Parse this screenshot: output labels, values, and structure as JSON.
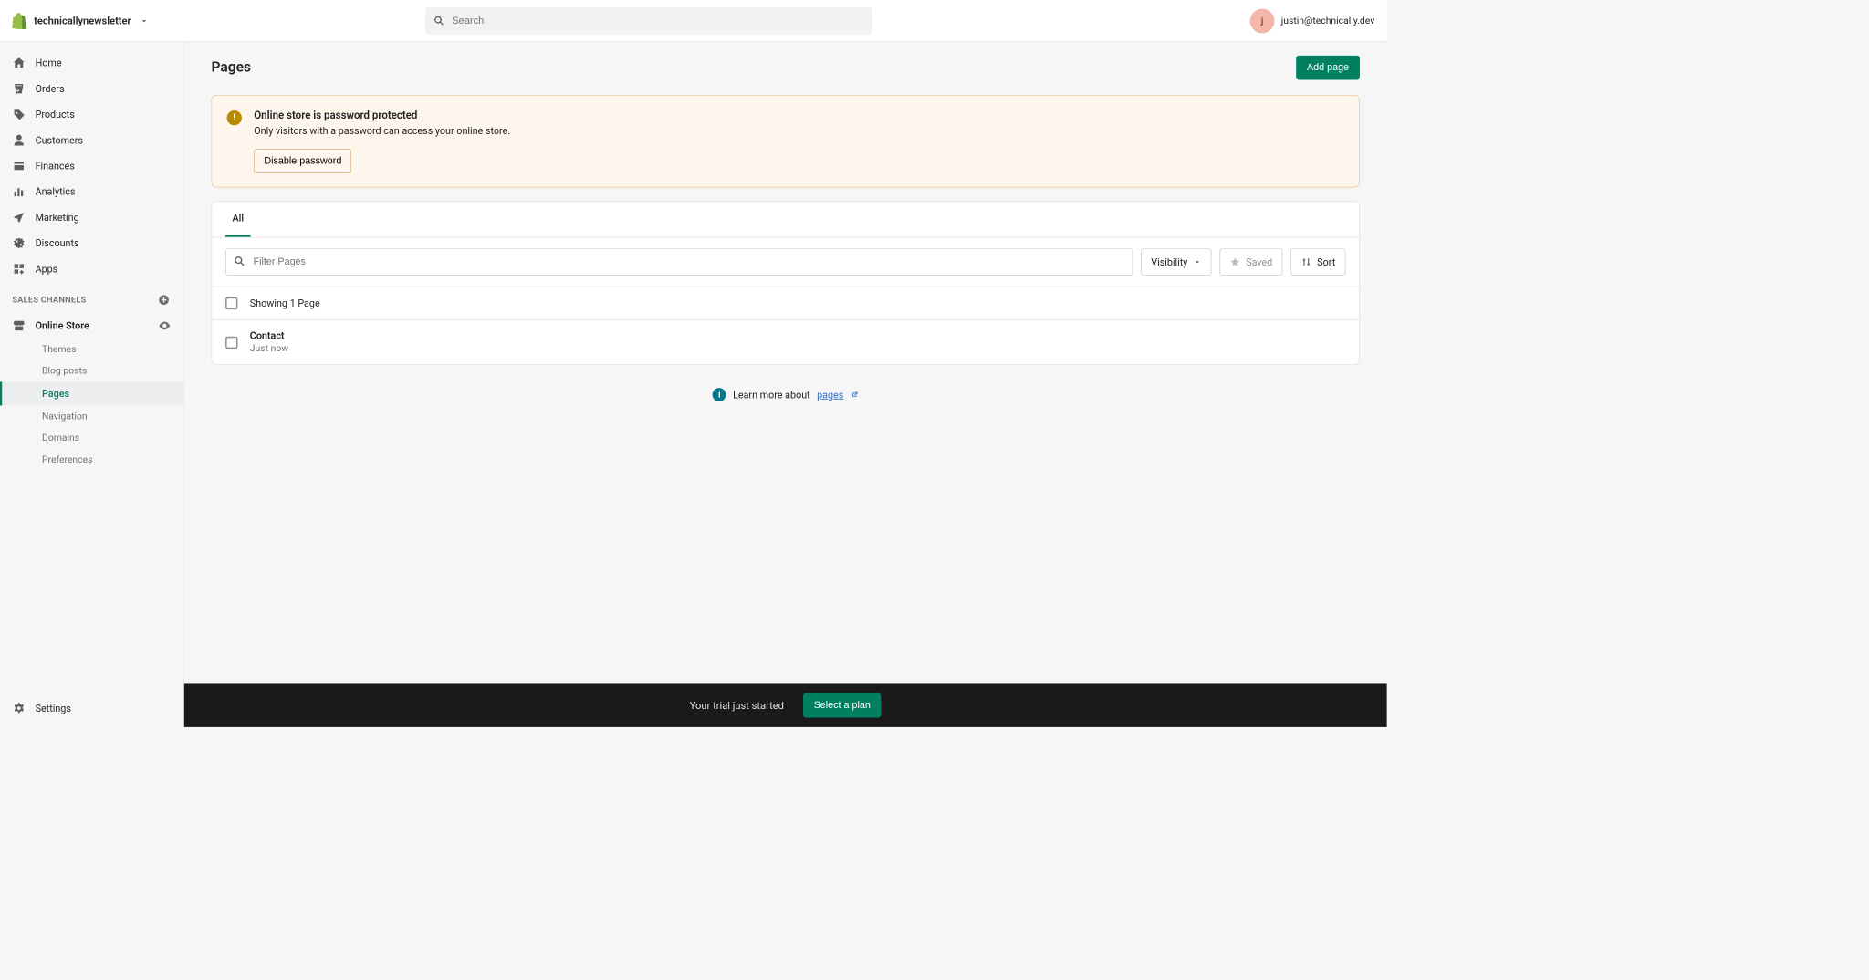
{
  "topbar": {
    "store_name": "technicallynewsletter",
    "search_placeholder": "Search",
    "avatar_initial": "j",
    "user_email": "justin@technically.dev"
  },
  "sidebar": {
    "items": [
      {
        "label": "Home",
        "icon": "home"
      },
      {
        "label": "Orders",
        "icon": "orders"
      },
      {
        "label": "Products",
        "icon": "products"
      },
      {
        "label": "Customers",
        "icon": "customers"
      },
      {
        "label": "Finances",
        "icon": "finances"
      },
      {
        "label": "Analytics",
        "icon": "analytics"
      },
      {
        "label": "Marketing",
        "icon": "marketing"
      },
      {
        "label": "Discounts",
        "icon": "discounts"
      },
      {
        "label": "Apps",
        "icon": "apps"
      }
    ],
    "section_header": "SALES CHANNELS",
    "online_store_label": "Online Store",
    "sub_items": [
      {
        "label": "Themes"
      },
      {
        "label": "Blog posts"
      },
      {
        "label": "Pages",
        "active": true
      },
      {
        "label": "Navigation"
      },
      {
        "label": "Domains"
      },
      {
        "label": "Preferences"
      }
    ],
    "settings_label": "Settings"
  },
  "page": {
    "title": "Pages",
    "add_button": "Add page"
  },
  "banner": {
    "title": "Online store is password protected",
    "body": "Only visitors with a password can access your online store.",
    "action": "Disable password"
  },
  "tabs": {
    "all": "All"
  },
  "toolbar": {
    "filter_placeholder": "Filter Pages",
    "visibility": "Visibility",
    "saved": "Saved",
    "sort": "Sort"
  },
  "list": {
    "summary": "Showing 1 Page",
    "rows": [
      {
        "title": "Contact",
        "subtitle": "Just now"
      }
    ]
  },
  "learn_more": {
    "prefix": "Learn more about ",
    "link": "pages"
  },
  "trialbar": {
    "text": "Your trial just started",
    "button": "Select a plan"
  }
}
